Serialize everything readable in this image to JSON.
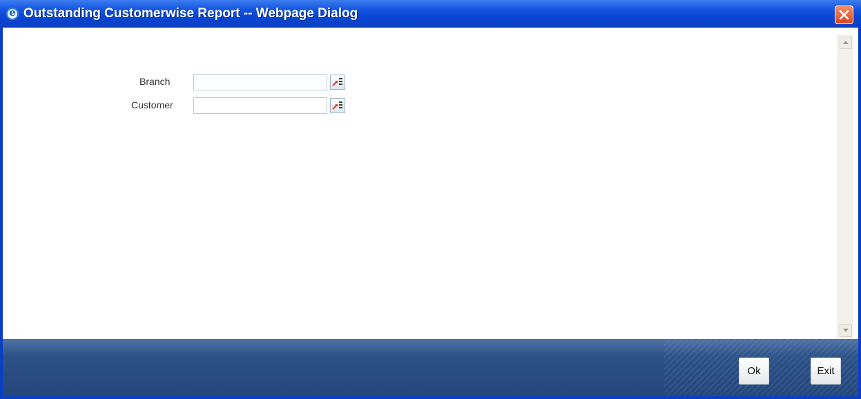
{
  "window": {
    "title": "Outstanding Customerwise Report -- Webpage Dialog",
    "app_icon": "ie-icon",
    "close_icon": "close-icon"
  },
  "form": {
    "branch": {
      "label": "Branch",
      "value": "",
      "lov_icon": "list-of-values-icon"
    },
    "customer": {
      "label": "Customer",
      "value": "",
      "lov_icon": "list-of-values-icon"
    }
  },
  "footer": {
    "ok_label": "Ok",
    "exit_label": "Exit"
  },
  "colors": {
    "titlebar": "#0a45d4",
    "footer": "#2d5288",
    "close_button": "#d9441c"
  }
}
